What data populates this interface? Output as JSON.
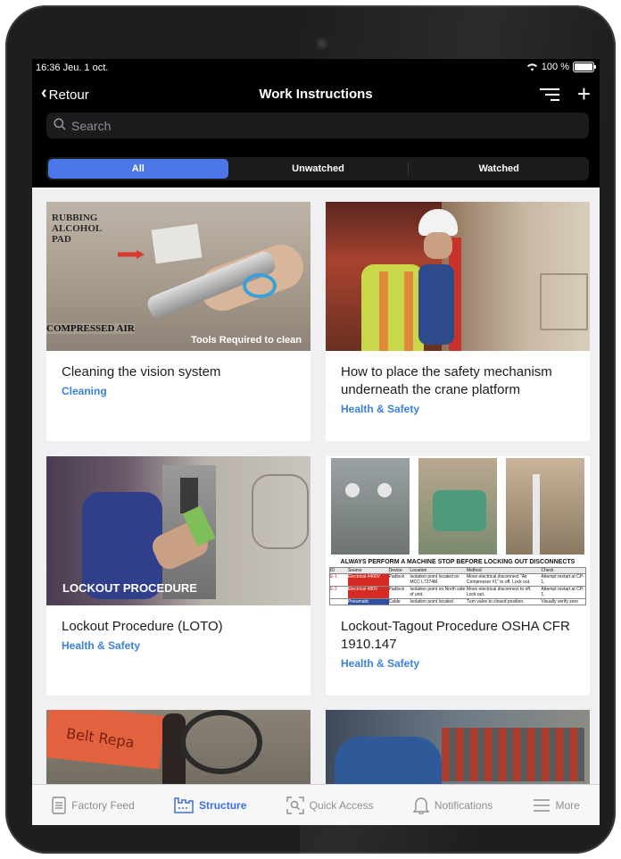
{
  "status": {
    "time": "16:36  Jeu. 1 oct.",
    "battery": "100 %"
  },
  "nav": {
    "back_label": "Retour",
    "title": "Work Instructions"
  },
  "search": {
    "placeholder": "Search"
  },
  "filters": {
    "all": "All",
    "unwatched": "Unwatched",
    "watched": "Watched"
  },
  "cards": [
    {
      "title": "Cleaning the vision system",
      "category": "Cleaning",
      "thumb_text": [
        "RUBBING",
        "ALCOHOL",
        "PAD",
        "COMPRESSED AIR",
        "Tools Required to clean"
      ]
    },
    {
      "title": "How to place the safety mechanism underneath the crane platform",
      "category": "Health & Safety"
    },
    {
      "title": "Lockout Procedure (LOTO)",
      "category": "Health & Safety",
      "thumb_text": [
        "LOCKOUT PROCEDURE"
      ]
    },
    {
      "title": "Lockout-Tagout Procedure OSHA CFR 1910.147",
      "category": "Health & Safety",
      "thumb_text": [
        "ALWAYS PERFORM A MACHINE STOP BEFORE LOCKING OUT DISCONNECTS"
      ],
      "thumb_table": {
        "headers": [
          "ID",
          "Source",
          "Device",
          "Location",
          "Method",
          "Check"
        ],
        "rows": [
          [
            "E-1",
            "Electrical 4400V",
            "Padlock",
            "Isolation point located on MCC L7274M.",
            "Move electrical disconnect \"Air Compressor #1\" to off. Lock out.",
            "Attempt restart at CP-1."
          ],
          [
            "E-2",
            "Electrical 480V",
            "Padlock",
            "Isolation point on North side of unit.",
            "Move electrical disconnect to off. Lock out.",
            "Attempt restart at CP-1."
          ],
          [
            "",
            "Pneumatic",
            "Cable",
            "Isolation point located",
            "Turn valve to closed position.",
            "Visually verify zero"
          ]
        ]
      }
    },
    {
      "title": "",
      "category": "",
      "thumb_text": [
        "Belt Repa"
      ]
    },
    {
      "title": "",
      "category": ""
    }
  ],
  "tabs": [
    {
      "label": "Factory Feed",
      "active": false
    },
    {
      "label": "Structure",
      "active": true
    },
    {
      "label": "Quick Access",
      "active": false
    },
    {
      "label": "Notifications",
      "active": false
    },
    {
      "label": "More",
      "active": false
    }
  ],
  "colors": {
    "accent": "#4a76e8",
    "category": "#3b82d8",
    "tab_active": "#3d6fe0"
  }
}
